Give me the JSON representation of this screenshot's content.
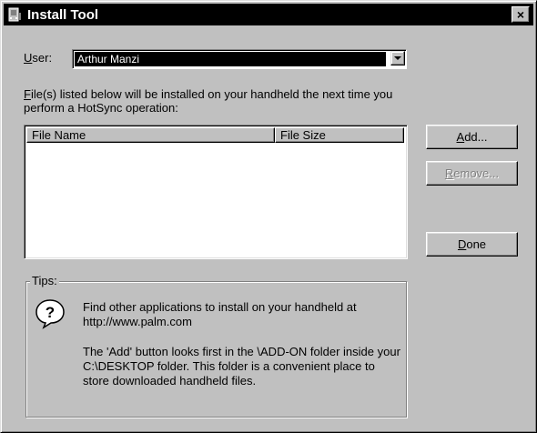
{
  "window": {
    "title": "Install Tool",
    "icon": "palm-install-icon",
    "close_label": "×"
  },
  "user": {
    "label_underlined": "U",
    "label_rest": "ser:",
    "selected": "Arthur Manzi"
  },
  "description": {
    "underlined": "F",
    "rest": "ile(s) listed below will be installed on your handheld the next time you perform a HotSync operation:"
  },
  "file_list": {
    "columns": [
      "File Name",
      "File Size"
    ],
    "rows": []
  },
  "buttons": {
    "add": {
      "underlined": "A",
      "rest": "dd..."
    },
    "remove": {
      "underlined": "R",
      "rest": "emove..."
    },
    "done": {
      "underlined": "D",
      "rest": "one"
    }
  },
  "tips": {
    "title": "Tips:",
    "icon": "question-icon",
    "tip1": "Find other applications to install on your handheld at http://www.palm.com",
    "tip2": "The 'Add' button looks first in the \\ADD-ON folder inside your C:\\DESKTOP folder. This folder is a convenient place to store downloaded handheld files."
  }
}
